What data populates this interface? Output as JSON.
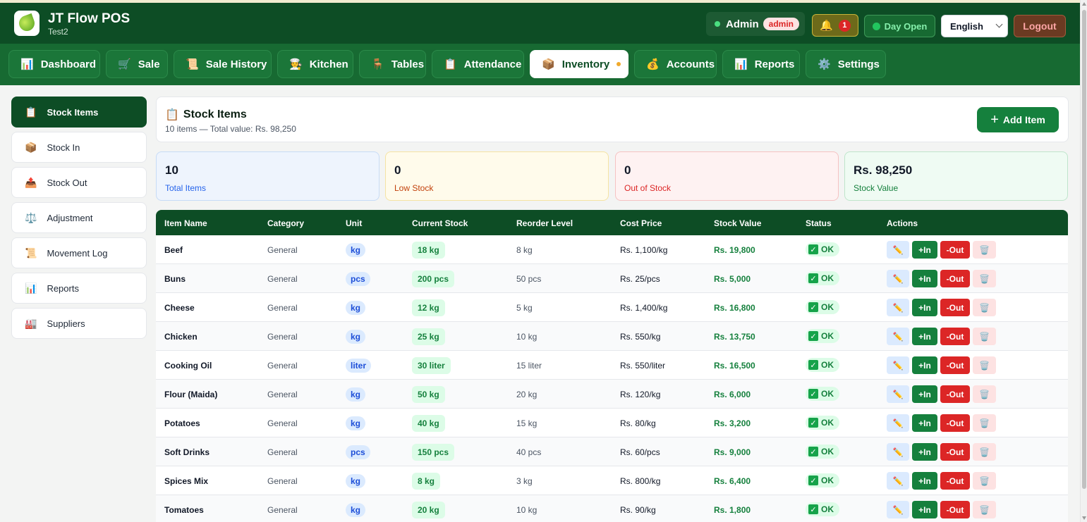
{
  "app": {
    "name": "JT Flow POS",
    "subtitle": "Test2"
  },
  "header": {
    "user_name": "Admin",
    "user_role": "admin",
    "notification_count": "1",
    "day_status": "Day Open",
    "language": "English",
    "logout": "Logout"
  },
  "nav": {
    "tabs": [
      {
        "label": "Dashboard",
        "icon": "chart-icon"
      },
      {
        "label": "Sale",
        "icon": "cart-icon"
      },
      {
        "label": "Sale History",
        "icon": "scroll-icon"
      },
      {
        "label": "Kitchen",
        "icon": "chef-icon"
      },
      {
        "label": "Tables",
        "icon": "chair-icon"
      },
      {
        "label": "Attendance",
        "icon": "clipboard-icon"
      },
      {
        "label": "Inventory",
        "icon": "box-icon",
        "active": true
      },
      {
        "label": "Accounts",
        "icon": "money-bag-icon"
      },
      {
        "label": "Reports",
        "icon": "chart-icon"
      },
      {
        "label": "Settings",
        "icon": "gear-icon"
      }
    ]
  },
  "sidebar": {
    "items": [
      {
        "label": "Stock Items",
        "icon": "clipboard-icon",
        "active": true
      },
      {
        "label": "Stock In",
        "icon": "box-icon"
      },
      {
        "label": "Stock Out",
        "icon": "outbox-icon"
      },
      {
        "label": "Adjustment",
        "icon": "scales-icon"
      },
      {
        "label": "Movement Log",
        "icon": "scroll-icon"
      },
      {
        "label": "Reports",
        "icon": "chart-icon"
      },
      {
        "label": "Suppliers",
        "icon": "factory-icon"
      }
    ]
  },
  "panel": {
    "title": "Stock Items",
    "subtitle": "10 items — Total value: Rs. 98,250",
    "add_button": "Add Item"
  },
  "stats": {
    "total_items": {
      "value": "10",
      "label": "Total Items"
    },
    "low_stock": {
      "value": "0",
      "label": "Low Stock"
    },
    "out_of_stock": {
      "value": "0",
      "label": "Out of Stock"
    },
    "stock_value": {
      "value": "Rs. 98,250",
      "label": "Stock Value"
    }
  },
  "table": {
    "headers": [
      "Item Name",
      "Category",
      "Unit",
      "Current Stock",
      "Reorder Level",
      "Cost Price",
      "Stock Value",
      "Status",
      "Actions"
    ],
    "rows": [
      {
        "name": "Beef",
        "category": "General",
        "unit": "kg",
        "stock": "18 kg",
        "reorder": "8 kg",
        "cost": "Rs. 1,100/kg",
        "value": "Rs. 19,800",
        "status": "OK"
      },
      {
        "name": "Buns",
        "category": "General",
        "unit": "pcs",
        "stock": "200 pcs",
        "reorder": "50 pcs",
        "cost": "Rs. 25/pcs",
        "value": "Rs. 5,000",
        "status": "OK"
      },
      {
        "name": "Cheese",
        "category": "General",
        "unit": "kg",
        "stock": "12 kg",
        "reorder": "5 kg",
        "cost": "Rs. 1,400/kg",
        "value": "Rs. 16,800",
        "status": "OK"
      },
      {
        "name": "Chicken",
        "category": "General",
        "unit": "kg",
        "stock": "25 kg",
        "reorder": "10 kg",
        "cost": "Rs. 550/kg",
        "value": "Rs. 13,750",
        "status": "OK"
      },
      {
        "name": "Cooking Oil",
        "category": "General",
        "unit": "liter",
        "stock": "30 liter",
        "reorder": "15 liter",
        "cost": "Rs. 550/liter",
        "value": "Rs. 16,500",
        "status": "OK"
      },
      {
        "name": "Flour (Maida)",
        "category": "General",
        "unit": "kg",
        "stock": "50 kg",
        "reorder": "20 kg",
        "cost": "Rs. 120/kg",
        "value": "Rs. 6,000",
        "status": "OK"
      },
      {
        "name": "Potatoes",
        "category": "General",
        "unit": "kg",
        "stock": "40 kg",
        "reorder": "15 kg",
        "cost": "Rs. 80/kg",
        "value": "Rs. 3,200",
        "status": "OK"
      },
      {
        "name": "Soft Drinks",
        "category": "General",
        "unit": "pcs",
        "stock": "150 pcs",
        "reorder": "40 pcs",
        "cost": "Rs. 60/pcs",
        "value": "Rs. 9,000",
        "status": "OK"
      },
      {
        "name": "Spices Mix",
        "category": "General",
        "unit": "kg",
        "stock": "8 kg",
        "reorder": "3 kg",
        "cost": "Rs. 800/kg",
        "value": "Rs. 6,400",
        "status": "OK"
      },
      {
        "name": "Tomatoes",
        "category": "General",
        "unit": "kg",
        "stock": "20 kg",
        "reorder": "10 kg",
        "cost": "Rs. 90/kg",
        "value": "Rs. 1,800",
        "status": "OK"
      }
    ],
    "actions": {
      "edit_icon": "pencil-icon",
      "in_label": "+In",
      "out_label": "-Out",
      "delete_icon": "trash-icon"
    }
  },
  "colors": {
    "header_bg": "#0d4d25",
    "nav_bg": "#176a32",
    "accent_green": "#15803d",
    "danger_red": "#dc2626"
  }
}
